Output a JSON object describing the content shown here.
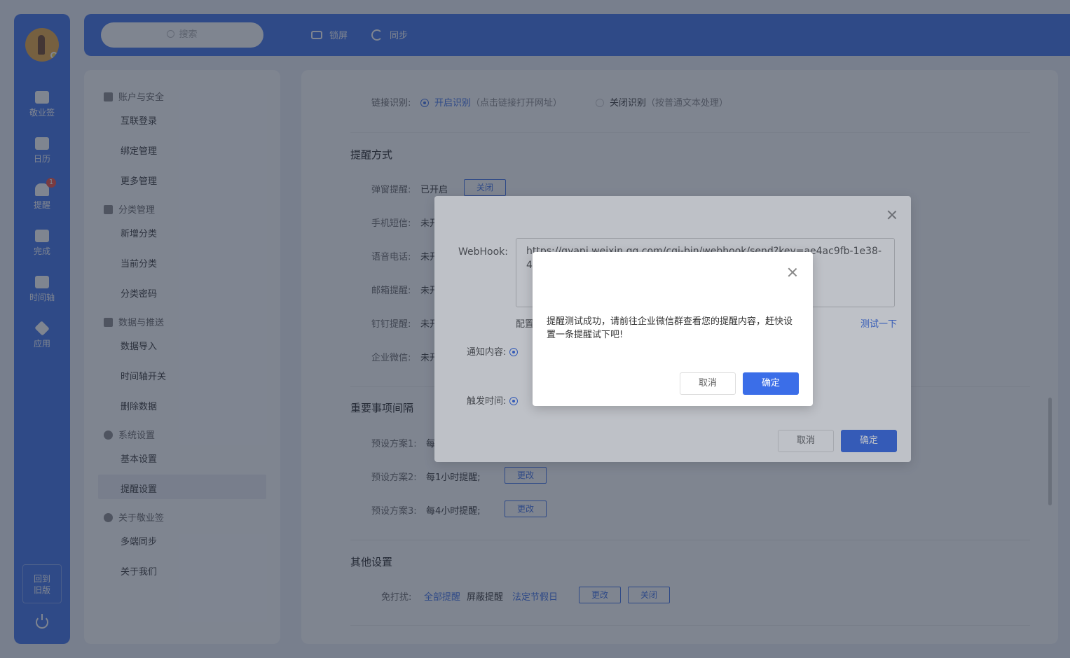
{
  "rail": {
    "items": [
      {
        "label": "敬业签",
        "icon": "cloud-note-icon"
      },
      {
        "label": "日历",
        "icon": "calendar-icon"
      },
      {
        "label": "提醒",
        "icon": "bell-icon",
        "badge": "1"
      },
      {
        "label": "完成",
        "icon": "check-clipboard-icon"
      },
      {
        "label": "时间轴",
        "icon": "timeline-icon"
      },
      {
        "label": "应用",
        "icon": "cube-icon"
      }
    ],
    "old_version_line1": "回到",
    "old_version_line2": "旧版"
  },
  "topbar": {
    "search_placeholder": "搜索",
    "lock_label": "锁屏",
    "sync_label": "同步"
  },
  "nav": {
    "groups": [
      {
        "title": "账户与安全",
        "items": [
          "互联登录",
          "绑定管理",
          "更多管理"
        ]
      },
      {
        "title": "分类管理",
        "items": [
          "新增分类",
          "当前分类",
          "分类密码"
        ]
      },
      {
        "title": "数据与推送",
        "items": [
          "数据导入",
          "时间轴开关",
          "删除数据"
        ]
      },
      {
        "title": "系统设置",
        "items": [
          "基本设置",
          "提醒设置"
        ]
      },
      {
        "title": "关于敬业签",
        "items": [
          "多端同步",
          "关于我们"
        ]
      }
    ],
    "active": "提醒设置"
  },
  "content": {
    "link_detect_label": "链接识别:",
    "link_on": "开启识别",
    "link_on_hint": "（点击链接打开网址）",
    "link_off": "关闭识别",
    "link_off_hint": "（按普通文本处理）",
    "remind_title": "提醒方式",
    "popup_label": "弹窗提醒:",
    "popup_value": "已开启",
    "popup_btn": "关闭",
    "sms_label": "手机短信:",
    "voice_label": "语音电话:",
    "mail_label": "邮箱提醒:",
    "ding_label": "钉钉提醒:",
    "wecom_label": "企业微信:",
    "not_open": "未开",
    "interval_title": "重要事项间隔",
    "preset1_label": "预设方案1:",
    "preset1_value": "每",
    "preset2_label": "预设方案2:",
    "preset2_value": "每1小时提醒;",
    "preset3_label": "预设方案3:",
    "preset3_value": "每4小时提醒;",
    "change_btn": "更改",
    "other_title": "其他设置",
    "dnd_label": "免打扰:",
    "dnd_all": "全部提醒",
    "dnd_block": "屏蔽提醒",
    "dnd_holiday": "法定节假日",
    "dnd_change": "更改",
    "dnd_close": "关闭"
  },
  "webhook_dialog": {
    "webhook_label": "WebHook:",
    "webhook_value": "https://qyapi.weixin.qq.com/cgi-bin/webhook/send?key=ae4ac9fb-1e38-444",
    "config_text": "配置",
    "test_link": "测试一下",
    "notify_label": "通知内容:",
    "trigger_label": "触发时间:",
    "cancel": "取消",
    "ok": "确定"
  },
  "message_box": {
    "text": "提醒测试成功，请前往企业微信群查看您的提醒内容，赶快设置一条提醒试下吧!",
    "cancel": "取消",
    "ok": "确定"
  },
  "colors": {
    "accent": "#3b6ee8",
    "badge": "#f04a3b"
  }
}
